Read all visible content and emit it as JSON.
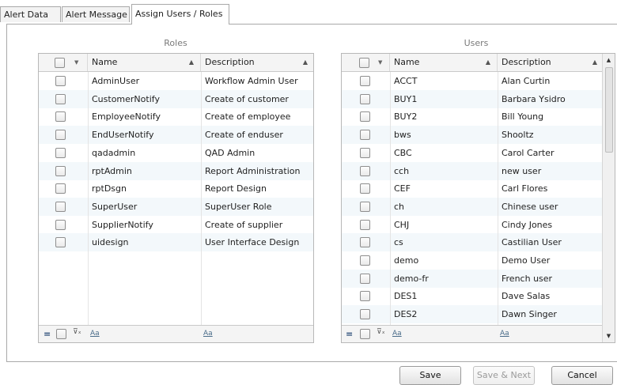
{
  "tabs": [
    {
      "label": "Alert Data",
      "active": false
    },
    {
      "label": "Alert Message",
      "active": false
    },
    {
      "label": "Assign Users / Roles",
      "active": true
    }
  ],
  "roles": {
    "title": "Roles",
    "columns": {
      "name": "Name",
      "description": "Description"
    },
    "rows": [
      {
        "name": "AdminUser",
        "description": "Workflow Admin User"
      },
      {
        "name": "CustomerNotify",
        "description": "Create of customer"
      },
      {
        "name": "EmployeeNotify",
        "description": "Create of employee"
      },
      {
        "name": "EndUserNotify",
        "description": "Create of enduser"
      },
      {
        "name": "qadadmin",
        "description": "QAD Admin"
      },
      {
        "name": "rptAdmin",
        "description": "Report Administration"
      },
      {
        "name": "rptDsgn",
        "description": "Report Design"
      },
      {
        "name": "SuperUser",
        "description": "SuperUser Role"
      },
      {
        "name": "SupplierNotify",
        "description": "Create of supplier"
      },
      {
        "name": "uidesign",
        "description": "User Interface Design"
      }
    ],
    "footer": {
      "filter_name": "Aa",
      "filter_desc": "Aa"
    }
  },
  "users": {
    "title": "Users",
    "columns": {
      "name": "Name",
      "description": "Description"
    },
    "rows": [
      {
        "name": "ACCT",
        "description": "Alan Curtin"
      },
      {
        "name": "BUY1",
        "description": "Barbara Ysidro"
      },
      {
        "name": "BUY2",
        "description": "Bill Young"
      },
      {
        "name": "bws",
        "description": " Shooltz"
      },
      {
        "name": "CBC",
        "description": "Carol Carter"
      },
      {
        "name": "cch",
        "description": "new user"
      },
      {
        "name": "CEF",
        "description": "Carl Flores"
      },
      {
        "name": "ch",
        "description": "Chinese user"
      },
      {
        "name": "CHJ",
        "description": "Cindy Jones"
      },
      {
        "name": "cs",
        "description": "Castilian User"
      },
      {
        "name": "demo",
        "description": "Demo User"
      },
      {
        "name": "demo-fr",
        "description": "French user"
      },
      {
        "name": "DES1",
        "description": "Dave Salas"
      },
      {
        "name": "DES2",
        "description": "Dawn Singer"
      }
    ],
    "footer": {
      "filter_name": "Aa",
      "filter_desc": "Aa"
    }
  },
  "buttons": {
    "save": "Save",
    "save_next": "Save & Next",
    "cancel": "Cancel"
  }
}
